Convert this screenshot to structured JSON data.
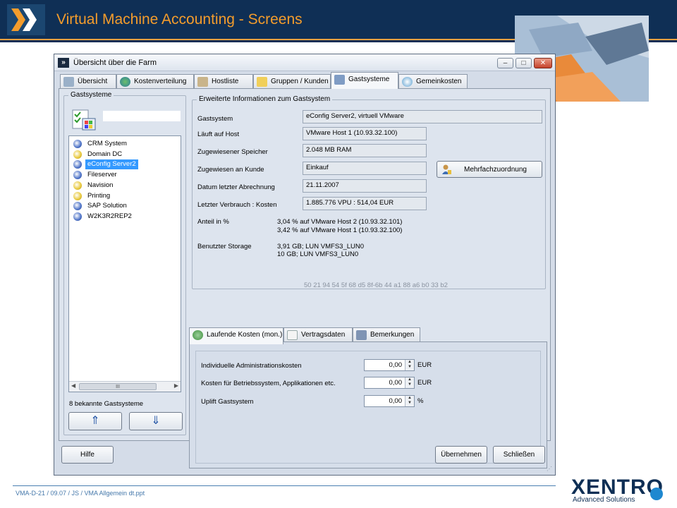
{
  "slide": {
    "title": "Virtual Machine Accounting - Screens",
    "footer": "VMA-D-21 / 09.07 / JS / VMA Allgemein dt.ppt",
    "brand": "XENTRO",
    "brand_subtitle": "Advanced Solutions",
    "accent_color": "#f39c2c",
    "header_color": "#0f2f55"
  },
  "window": {
    "title": "Übersicht über die Farm",
    "controls": {
      "minimize": "–",
      "maximize": "□",
      "close": "✕"
    },
    "tabs": [
      {
        "label": "Übersicht",
        "icon": "overview-icon"
      },
      {
        "label": "Kostenverteilung",
        "icon": "pie-chart-icon"
      },
      {
        "label": "Hostliste",
        "icon": "server-icon"
      },
      {
        "label": "Gruppen / Kunden",
        "icon": "folder-icon"
      },
      {
        "label": "Gastsysteme",
        "icon": "monitor-icon",
        "active": true
      },
      {
        "label": "Gemeinkosten",
        "icon": "cost-icon"
      }
    ]
  },
  "guests": {
    "group_title": "Gastsysteme",
    "filter_value": "",
    "items": [
      {
        "label": "CRM System",
        "icon": "vm-globe-icon"
      },
      {
        "label": "Domain DC",
        "icon": "vm-globe-icon"
      },
      {
        "label": "eConfig Server2",
        "icon": "vm-globe-icon",
        "selected": true
      },
      {
        "label": "Fileserver",
        "icon": "vm-globe-icon"
      },
      {
        "label": "Navision",
        "icon": "vm-globe-icon"
      },
      {
        "label": "Printing",
        "icon": "vm-globe-icon"
      },
      {
        "label": "SAP Solution",
        "icon": "vm-globe-icon"
      },
      {
        "label": "W2K3R2REP2",
        "icon": "vm-globe-icon"
      }
    ],
    "count_text": "8 bekannte Gastsysteme",
    "up_button": "⇑",
    "down_button": "⇓"
  },
  "details": {
    "group_title": "Erweiterte Informationen zum Gastsystem",
    "rows": [
      {
        "label": "Gastsystem",
        "value": "eConfig Server2, virtuell VMware"
      },
      {
        "label": "Läuft auf Host",
        "value": "VMware Host 1 (10.93.32.100)"
      },
      {
        "label": "Zugewiesener Speicher",
        "value": "2.048 MB RAM"
      },
      {
        "label": "Zugewiesen an Kunde",
        "value": "Einkauf"
      },
      {
        "label": "Datum letzter Abrechnung",
        "value": "21.11.2007"
      },
      {
        "label": "Letzter Verbrauch : Kosten",
        "value": "1.885.776 VPU : 514,04 EUR"
      }
    ],
    "share_label": "Anteil in %",
    "share_lines": [
      "3,04 % auf VMware Host 2 (10.93.32.101)",
      "3,42 % auf VMware Host 1 (10.93.32.100)"
    ],
    "storage_label": "Benutzter Storage",
    "storage_lines": [
      "3,91 GB; LUN VMFS3_LUN0",
      "10 GB; LUN VMFS3_LUN0"
    ],
    "uuid": "50 21 94 54 5f 68 d5 8f-6b 44 a1 88 a6 b0 33 b2",
    "multi_assign_button": "Mehrfachzuordnung"
  },
  "costs": {
    "tabs": [
      {
        "label": "Laufende Kosten (mon.)",
        "active": true
      },
      {
        "label": "Vertragsdaten"
      },
      {
        "label": "Bemerkungen"
      }
    ],
    "rows": [
      {
        "label": "Individuelle Administrationskosten",
        "value": "0,00",
        "unit": "EUR"
      },
      {
        "label": "Kosten für Betriebssystem, Applikationen etc.",
        "value": "0,00",
        "unit": "EUR"
      },
      {
        "label": "Uplift Gastsystem",
        "value": "0,00",
        "unit": "%"
      }
    ]
  },
  "buttons": {
    "help": "Hilfe",
    "apply": "Übernehmen",
    "close": "Schließen"
  }
}
